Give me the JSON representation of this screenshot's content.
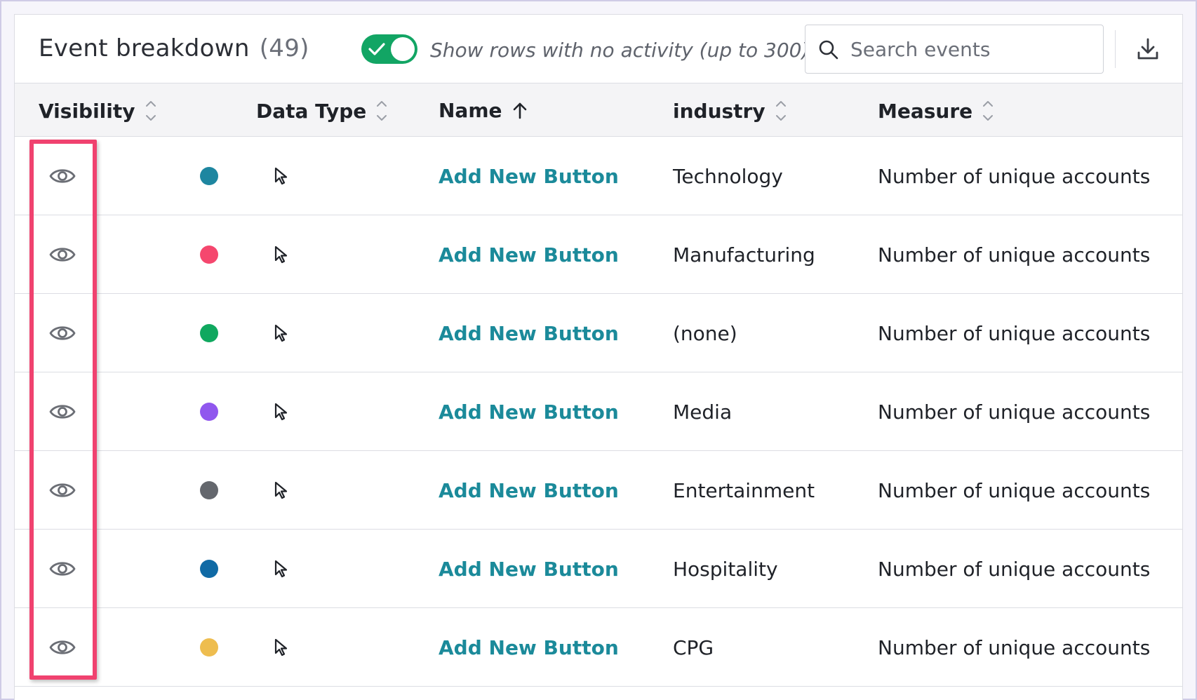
{
  "header": {
    "title": "Event breakdown",
    "count": "(49)",
    "toggle_label": "Show rows with no activity (up to 300)",
    "toggle_on": true,
    "search_placeholder": "Search events"
  },
  "columns": {
    "visibility": "Visibility",
    "data_type": "Data Type",
    "name": "Name",
    "industry": "industry",
    "measure": "Measure"
  },
  "colors": {
    "accent_green": "#12a564",
    "link_teal": "#1b8a9a",
    "highlight_pink": "#f0426f"
  },
  "rows": [
    {
      "color": "#1e86a0",
      "name": "Add New Button",
      "industry": "Technology",
      "measure": "Number of unique accounts"
    },
    {
      "color": "#f5476e",
      "name": "Add New Button",
      "industry": "Manufacturing",
      "measure": "Number of unique accounts"
    },
    {
      "color": "#10a85f",
      "name": "Add New Button",
      "industry": "(none)",
      "measure": "Number of unique accounts"
    },
    {
      "color": "#9057ee",
      "name": "Add New Button",
      "industry": "Media",
      "measure": "Number of unique accounts"
    },
    {
      "color": "#64676d",
      "name": "Add New Button",
      "industry": "Entertainment",
      "measure": "Number of unique accounts"
    },
    {
      "color": "#106aa5",
      "name": "Add New Button",
      "industry": "Hospitality",
      "measure": "Number of unique accounts"
    },
    {
      "color": "#eebd4f",
      "name": "Add New Button",
      "industry": "CPG",
      "measure": "Number of unique accounts"
    }
  ]
}
